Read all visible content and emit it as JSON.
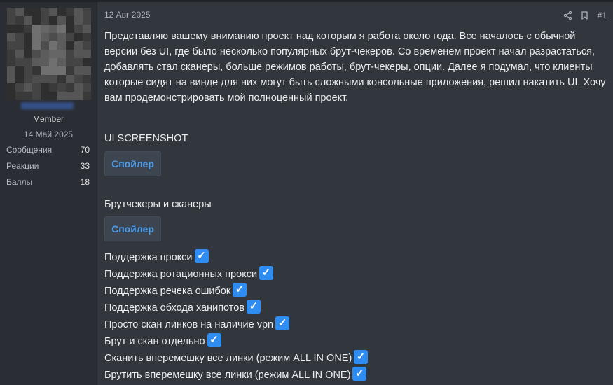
{
  "user": {
    "title": "Member",
    "join_date": "14 Май 2025",
    "stats": [
      {
        "label": "Сообщения",
        "value": "70"
      },
      {
        "label": "Реакции",
        "value": "33"
      },
      {
        "label": "Баллы",
        "value": "18"
      }
    ]
  },
  "post": {
    "date": "12 Авг 2025",
    "number": "#1",
    "body": "Представляю вашему вниманию проект над которым я работа около года. Все началось с обычной версии без UI, где было несколько популярных брут-чекеров. Со временем проект начал разрастаться, добавлять стал сканеры, больше режимов работы, брут-чекеры, опции. Далее я подумал, что клиенты которые сидят на винде для них могут быть сложными консольные приложения, решил накатить UI. Хочу вам продемонстрировать мой полноценный проект.",
    "section_1_title": "UI SCREENSHOT",
    "spoiler_1": "Спойлер",
    "section_2_title": "Брутчекеры и сканеры",
    "spoiler_2": "Спойлер",
    "features": [
      "Поддержка прокси",
      "Поддержка ротационных прокси",
      "Поддержка речека ошибок",
      "Поддержка обхода ханипотов",
      "Просто скан линков на наличие vpn",
      "Брут и скан отдельно",
      "Сканить вперемешку все линки (режим ALL IN ONE)",
      "Брутить вперемешку все линки (режим ALL IN ONE)"
    ],
    "check_glyph": "✓"
  },
  "icons": {
    "share": "share-icon",
    "bookmark": "bookmark-icon",
    "check": "check-mark-icon"
  },
  "colors": {
    "accent": "#4b9be8",
    "check_bg": "#2f8df2",
    "background": "#32363d",
    "sidebar": "#2a2d33"
  }
}
